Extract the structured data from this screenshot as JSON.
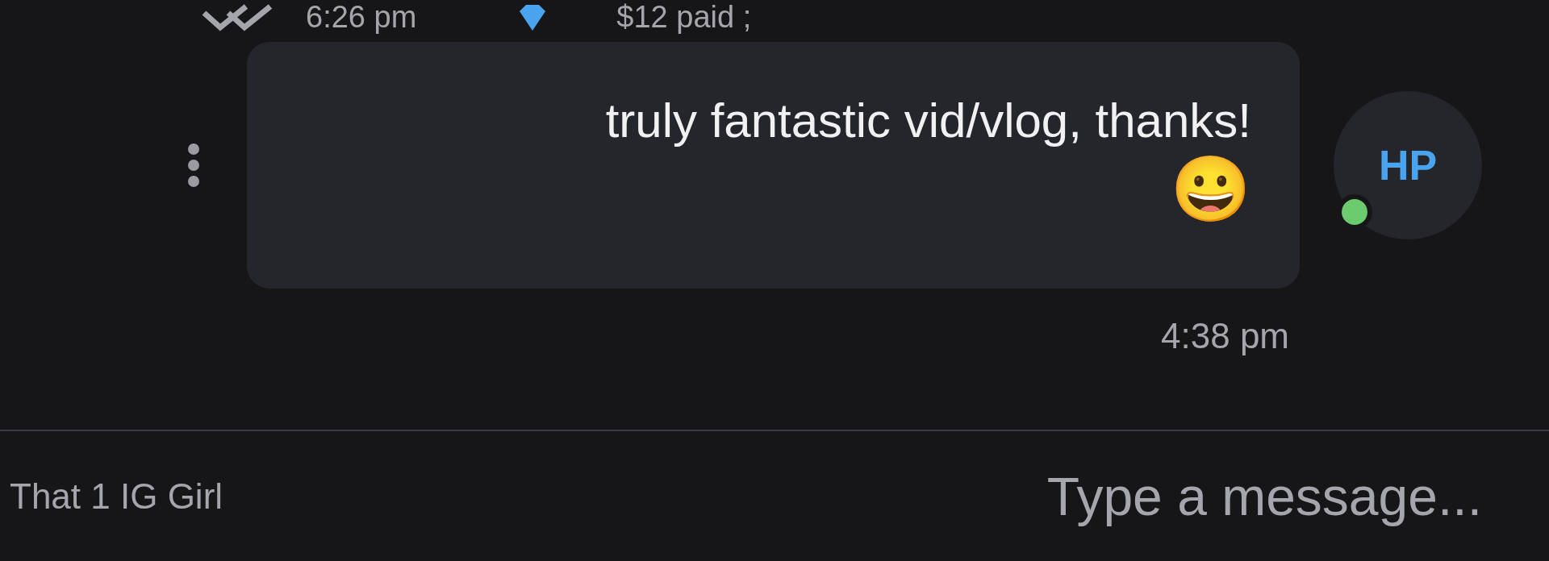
{
  "previous_message": {
    "amount": "$12 paid ;",
    "time": "6:26 pm"
  },
  "message": {
    "avatar": "HP",
    "online": true,
    "text": "truly fantastic vid/vlog, thanks!",
    "emoji": "😀",
    "time": "4:38 pm"
  },
  "composer": {
    "placeholder": "Type a message...",
    "recipient": "That 1 IG Girl"
  }
}
